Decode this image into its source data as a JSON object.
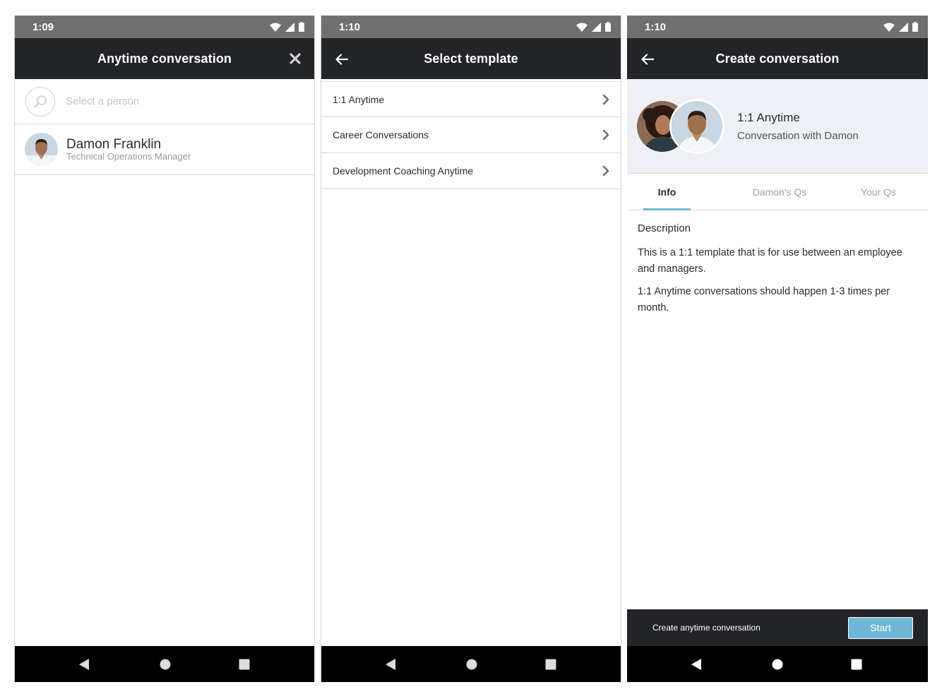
{
  "screen1": {
    "status_time": "1:09",
    "title": "Anytime conversation",
    "search_placeholder": "Select a person",
    "person": {
      "name": "Damon Franklin",
      "role": "Technical Operations Manager"
    }
  },
  "screen2": {
    "status_time": "1:10",
    "title": "Select template",
    "templates": [
      {
        "label": "1:1 Anytime"
      },
      {
        "label": "Career Conversations"
      },
      {
        "label": "Development Coaching Anytime"
      }
    ]
  },
  "screen3": {
    "status_time": "1:10",
    "title": "Create conversation",
    "header": {
      "title": "1:1 Anytime",
      "subtitle": "Conversation with Damon"
    },
    "tabs": [
      {
        "label": "Info",
        "active": true
      },
      {
        "label": "Damon's Qs",
        "active": false
      },
      {
        "label": "Your Qs",
        "active": false
      }
    ],
    "description_heading": "Description",
    "description_paragraphs": [
      "This is a 1:1 template that is for use between an employee and managers.",
      "1:1 Anytime conversations should happen 1-3 times per month."
    ],
    "action_label": "Create anytime conversation",
    "start_label": "Start"
  },
  "colors": {
    "status_bar": "#707070",
    "app_bar": "#232428",
    "nav_bar": "#000000",
    "accent": "#6fb7d6",
    "header_card": "#eef0f5"
  },
  "icons": [
    "wifi-icon",
    "signal-icon",
    "battery-icon",
    "close-icon",
    "back-arrow-icon",
    "search-icon",
    "chevron-right-icon",
    "nav-back-icon",
    "nav-home-icon",
    "nav-recents-icon"
  ]
}
